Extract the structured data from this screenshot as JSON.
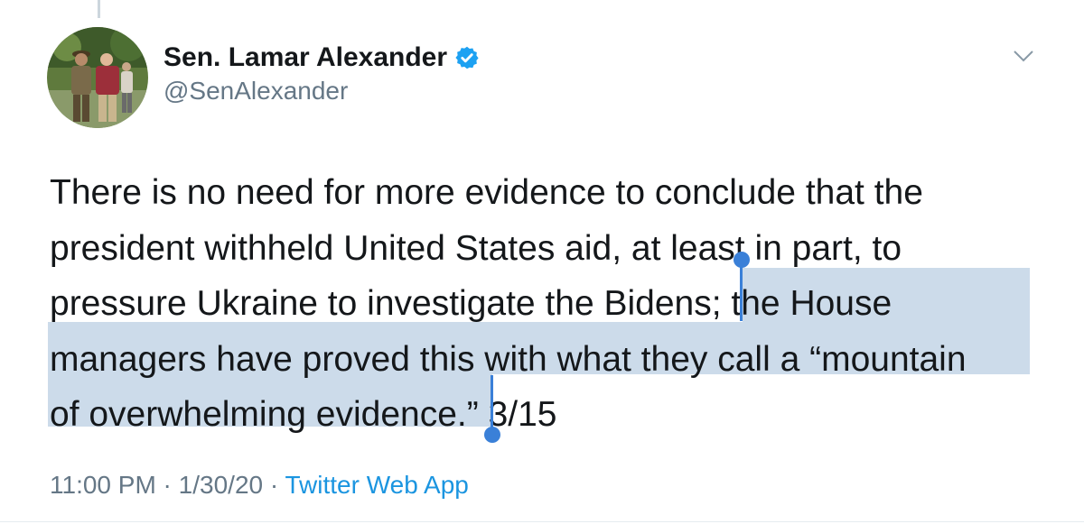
{
  "author": {
    "display_name": "Sen. Lamar Alexander",
    "handle": "@SenAlexander",
    "verified": true,
    "avatar_icon": "profile-photo"
  },
  "tweet": {
    "lines": [
      "There is no need for more evidence to conclude that the",
      "president withheld United States aid, at least in part, to",
      "pressure Ukraine to investigate the Bidens; ",
      "the House",
      "managers have proved this with what they call a “mountain",
      "of overwhelming evidence.”",
      " 3/15"
    ],
    "selected_text": "the House managers have proved this with what they call a “mountain of overwhelming evidence.”"
  },
  "meta": {
    "time": "11:00 PM",
    "separator1": " · ",
    "date": "1/30/20",
    "separator2": " · ",
    "source": "Twitter Web App"
  },
  "colors": {
    "text": "#14171a",
    "secondary": "#657786",
    "link": "#1b95e0",
    "verified": "#1da1f2",
    "selection": "#ccdbea",
    "selection_handle": "#3a80d8"
  },
  "icons": {
    "verified": "verified-badge-icon",
    "caret": "chevron-down-icon"
  }
}
